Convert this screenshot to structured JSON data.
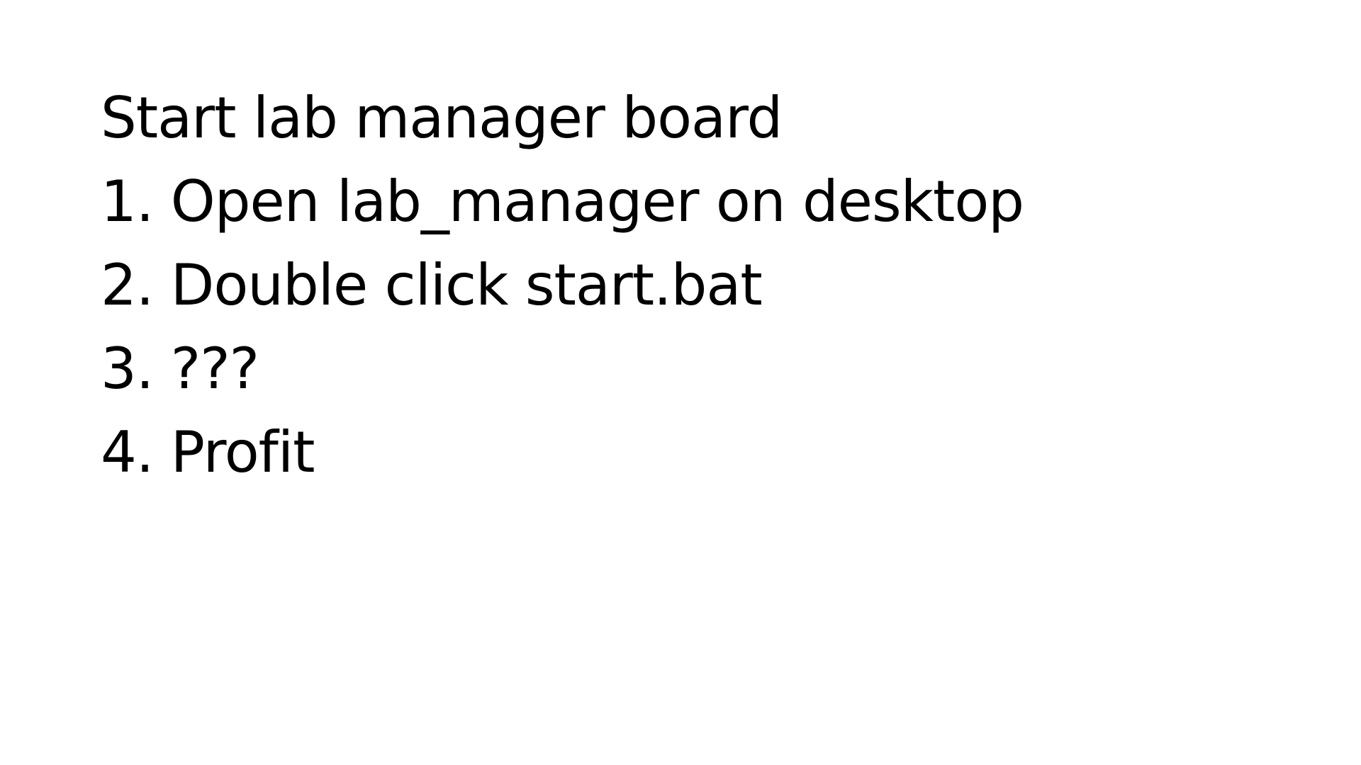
{
  "document": {
    "title": "Start lab manager board",
    "steps": [
      "1. Open lab_manager on desktop",
      "2. Double click start.bat",
      "3. ???",
      "4. Profit"
    ]
  }
}
